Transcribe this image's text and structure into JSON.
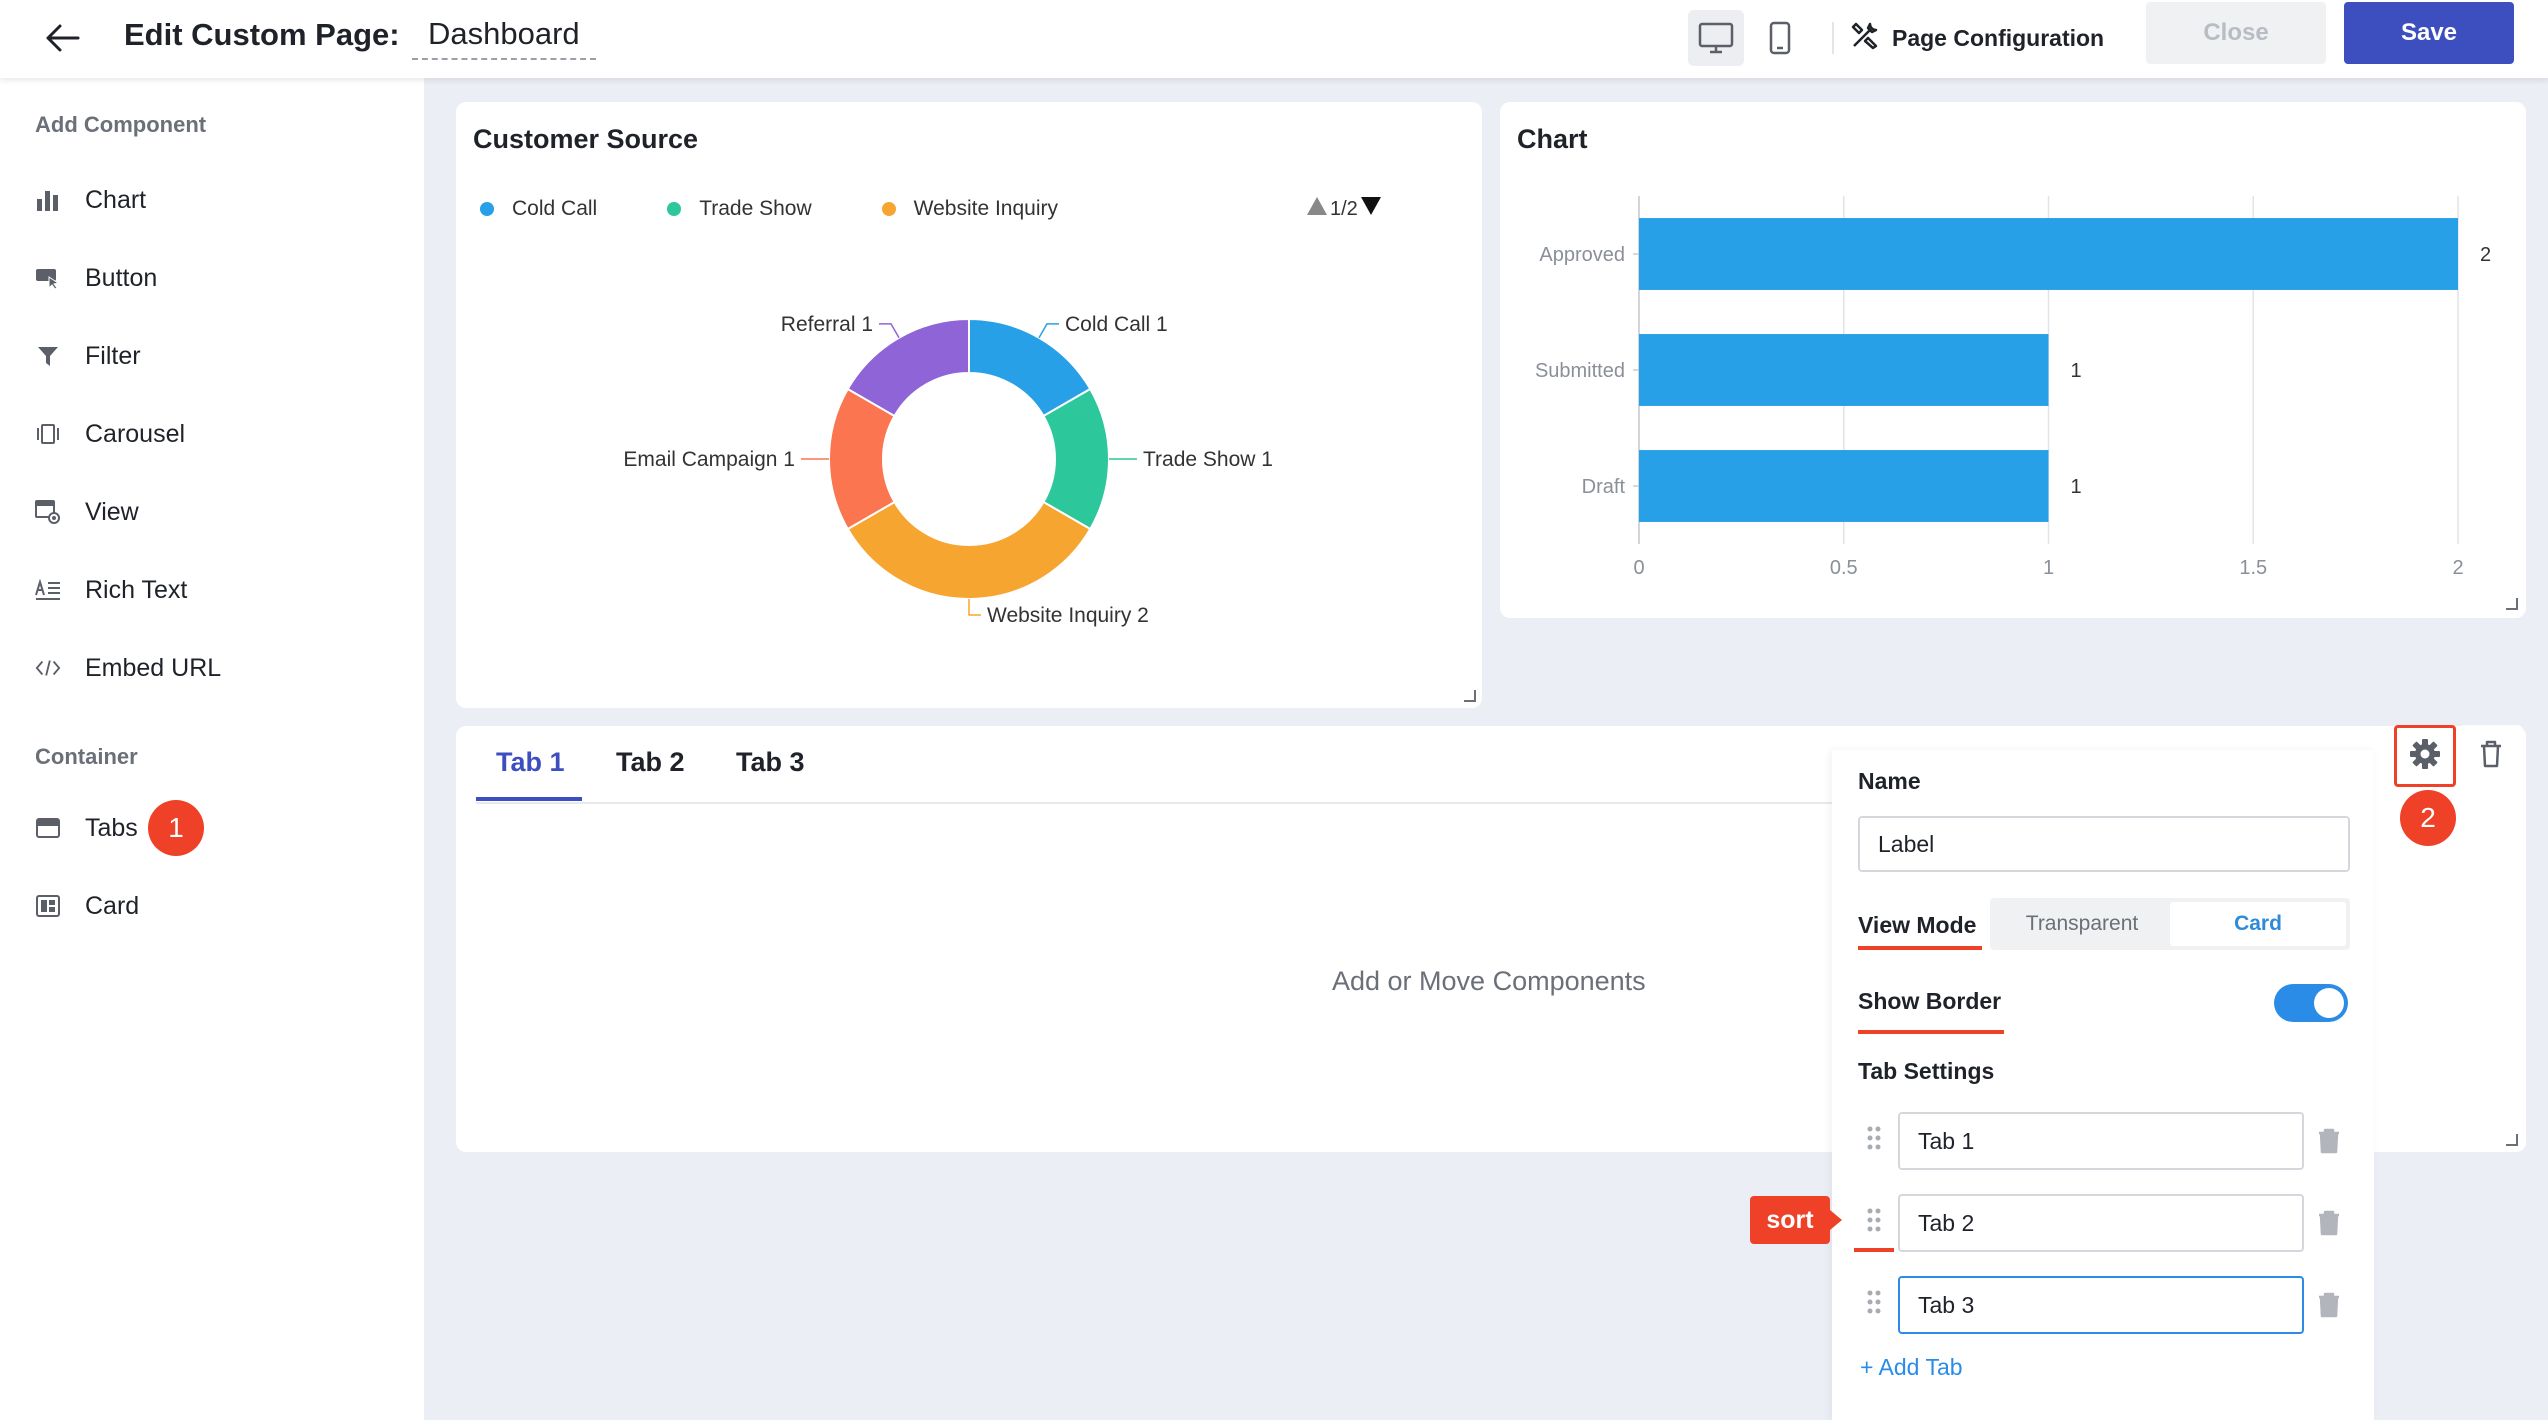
{
  "header": {
    "title": "Edit Custom Page:",
    "page_name": "Dashboard",
    "page_configuration": "Page Configuration",
    "close_label": "Close",
    "save_label": "Save"
  },
  "sidebar": {
    "add_component_title": "Add Component",
    "components": [
      {
        "label": "Chart",
        "icon": "bar-chart-icon"
      },
      {
        "label": "Button",
        "icon": "button-cursor-icon"
      },
      {
        "label": "Filter",
        "icon": "filter-funnel-icon"
      },
      {
        "label": "Carousel",
        "icon": "carousel-icon"
      },
      {
        "label": "View",
        "icon": "view-icon"
      },
      {
        "label": "Rich Text",
        "icon": "rich-text-icon"
      },
      {
        "label": "Embed URL",
        "icon": "code-brackets-icon"
      }
    ],
    "container_title": "Container",
    "containers": [
      {
        "label": "Tabs",
        "icon": "tabs-icon"
      },
      {
        "label": "Card",
        "icon": "card-icon"
      }
    ],
    "step_badge_1": "1"
  },
  "customer_source": {
    "title": "Customer Source",
    "legend": [
      "Cold Call",
      "Trade Show",
      "Website Inquiry"
    ],
    "legend_pager": "1/2"
  },
  "status_chart": {
    "title": "Chart"
  },
  "chart_data": [
    {
      "type": "pie",
      "title": "Customer Source",
      "donut": true,
      "categories": [
        "Cold Call",
        "Trade Show",
        "Website Inquiry",
        "Email Campaign",
        "Referral"
      ],
      "values": [
        1,
        1,
        2,
        1,
        1
      ],
      "colors": [
        "#27a0e8",
        "#2cc79a",
        "#f7a531",
        "#fa7550",
        "#8e64d7"
      ],
      "legend": [
        "Cold Call",
        "Trade Show",
        "Website Inquiry"
      ],
      "legend_position": "top"
    },
    {
      "type": "bar",
      "orientation": "horizontal",
      "title": "Chart",
      "categories": [
        "Approved",
        "Submitted",
        "Draft"
      ],
      "values": [
        2,
        1,
        1
      ],
      "xlim": [
        0,
        2
      ],
      "x_ticks": [
        "0",
        "0.5",
        "1",
        "1.5",
        "2"
      ],
      "color": "#27a0e8",
      "grid": true
    }
  ],
  "tabs_container": {
    "tabs": [
      "Tab 1",
      "Tab 2",
      "Tab 3"
    ],
    "active_tab": "Tab 1",
    "empty_hint": "Add or Move Components",
    "step_badge_2": "2"
  },
  "settings": {
    "name_label": "Name",
    "name_value": "Label",
    "view_mode_label": "View Mode",
    "view_mode_options": [
      "Transparent",
      "Card"
    ],
    "view_mode_selected": "Card",
    "show_border_label": "Show Border",
    "show_border_on": true,
    "tab_settings_label": "Tab Settings",
    "tab_entries": [
      "Tab 1",
      "Tab 2",
      "Tab 3"
    ],
    "add_tab_label": "+ Add Tab",
    "sort_tag": "sort"
  },
  "colors": {
    "accent": "#3d4ebf",
    "annotation_red": "#ee4127",
    "toggle_blue": "#2b8ce8",
    "bar_blue": "#27a0e8"
  }
}
